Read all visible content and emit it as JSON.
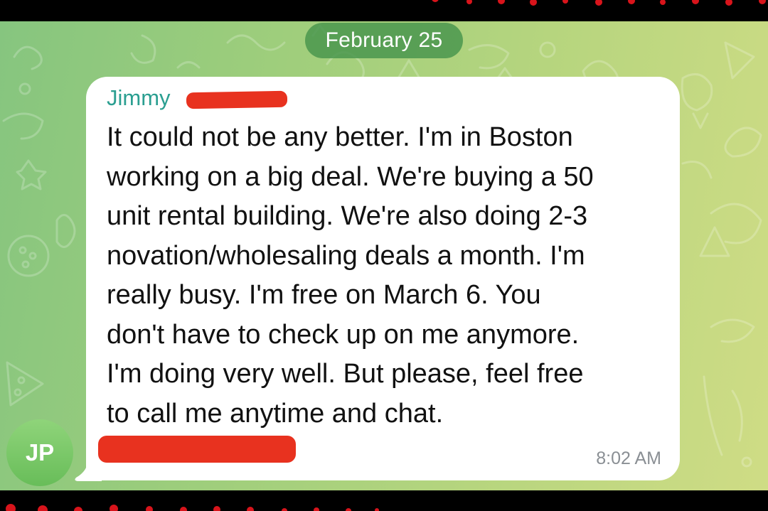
{
  "chat": {
    "date_separator": "February 25",
    "message": {
      "sender_name": "Jimmy",
      "text": "It could not be any better. I'm in Boston\nworking on a big deal. We're buying a 50\nunit rental building. We're also doing 2-3\nnovation/wholesaling deals a month. I'm\nreally busy. I'm free on March 6. You\ndon't have to check up on me anymore.\nI'm doing very well. But please, feel free\nto call me anytime and chat.",
      "time": "8:02 AM"
    },
    "avatar": {
      "initials": "JP",
      "color": "#72c462"
    }
  },
  "colors": {
    "sender_name": "#2b9f91",
    "bubble": "#ffffff",
    "redaction": "#e8321f",
    "wallpaper_left": "#86c57f",
    "wallpaper_right": "#cfdc85"
  },
  "icons": [
    "doodle-wallpaper-pattern"
  ]
}
